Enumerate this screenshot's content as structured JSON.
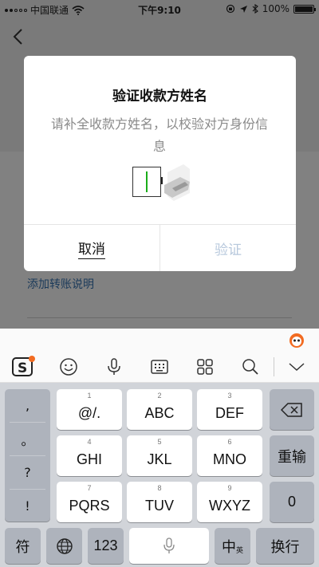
{
  "status_bar": {
    "carrier": "中国联通",
    "time": "下午9:10",
    "battery": "100%"
  },
  "background": {
    "transfer_note": "添加转账说明"
  },
  "dialog": {
    "title": "验证收款方姓名",
    "description": "请补全收款方姓名，以校验对方身份信息",
    "cancel_label": "取消",
    "verify_label": "验证"
  },
  "keyboard": {
    "punctuation": [
      ",",
      "。",
      "?",
      "!"
    ],
    "rows": [
      [
        {
          "num": "1",
          "label": "@/."
        },
        {
          "num": "2",
          "label": "ABC"
        },
        {
          "num": "3",
          "label": "DEF"
        }
      ],
      [
        {
          "num": "4",
          "label": "GHI"
        },
        {
          "num": "5",
          "label": "JKL"
        },
        {
          "num": "6",
          "label": "MNO"
        }
      ],
      [
        {
          "num": "7",
          "label": "PQRS"
        },
        {
          "num": "8",
          "label": "TUV"
        },
        {
          "num": "9",
          "label": "WXYZ"
        }
      ]
    ],
    "reenter_label": "重输",
    "zero_label": "0",
    "symbol_label": "符",
    "numbers_label": "123",
    "lang_main": "中",
    "lang_sub": "英",
    "enter_label": "换行"
  },
  "colors": {
    "accent_green": "#1aad19",
    "link_blue": "#576b95",
    "sogou_orange": "#f26b21"
  }
}
